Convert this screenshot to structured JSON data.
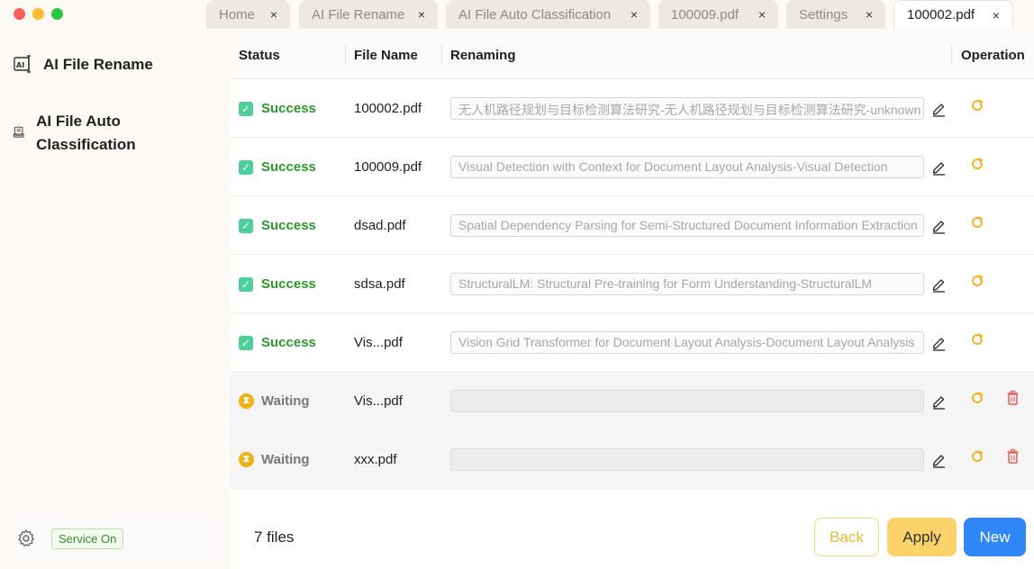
{
  "window": {
    "tabs": [
      {
        "label": "Home",
        "close": "×"
      },
      {
        "label": "AI File Rename",
        "close": "×"
      },
      {
        "label": "AI File Auto Classification",
        "close": "×"
      },
      {
        "label": "100009.pdf",
        "close": "×"
      },
      {
        "label": "Settings",
        "close": "×"
      },
      {
        "label": "100002.pdf",
        "close": "×",
        "active": true
      }
    ]
  },
  "sidebar": {
    "items": [
      {
        "label": "AI File Rename",
        "icon": "ai-rename-icon"
      },
      {
        "label": "AI File Auto Classification",
        "icon": "classification-icon"
      }
    ],
    "service_status": "Service On"
  },
  "table": {
    "headers": {
      "status": "Status",
      "file_name": "File Name",
      "renaming": "Renaming",
      "operation": "Operation"
    },
    "rows": [
      {
        "status": "Success",
        "file_name": "100002.pdf",
        "renaming": "无人机路径规划与目标检测算法研究-无人机路径规划与目标检测算法研究-unknown"
      },
      {
        "status": "Success",
        "file_name": "100009.pdf",
        "renaming": "Visual Detection with Context for Document Layout Analysis-Visual Detection"
      },
      {
        "status": "Success",
        "file_name": "dsad.pdf",
        "renaming": "Spatial Dependency Parsing for Semi-Structured Document Information Extraction"
      },
      {
        "status": "Success",
        "file_name": "sdsa.pdf",
        "renaming": "StructuralLM: Structural Pre-training for Form Understanding-StructuralLM"
      },
      {
        "status": "Success",
        "file_name": "Vis...pdf",
        "renaming": "Vision Grid Transformer for Document Layout Analysis-Document Layout Analysis"
      },
      {
        "status": "Waiting",
        "file_name": "Vis...pdf",
        "renaming": ""
      },
      {
        "status": "Waiting",
        "file_name": "xxx.pdf",
        "renaming": ""
      }
    ]
  },
  "footer": {
    "file_count": "7 files",
    "back_label": "Back",
    "apply_label": "Apply",
    "new_label": "New"
  },
  "colors": {
    "success": "#2a9a2a",
    "waiting_icon": "#f2b011",
    "refresh": "#f2b011",
    "delete": "#e0605a",
    "primary": "#2f86f6",
    "apply": "#fbd36a"
  }
}
